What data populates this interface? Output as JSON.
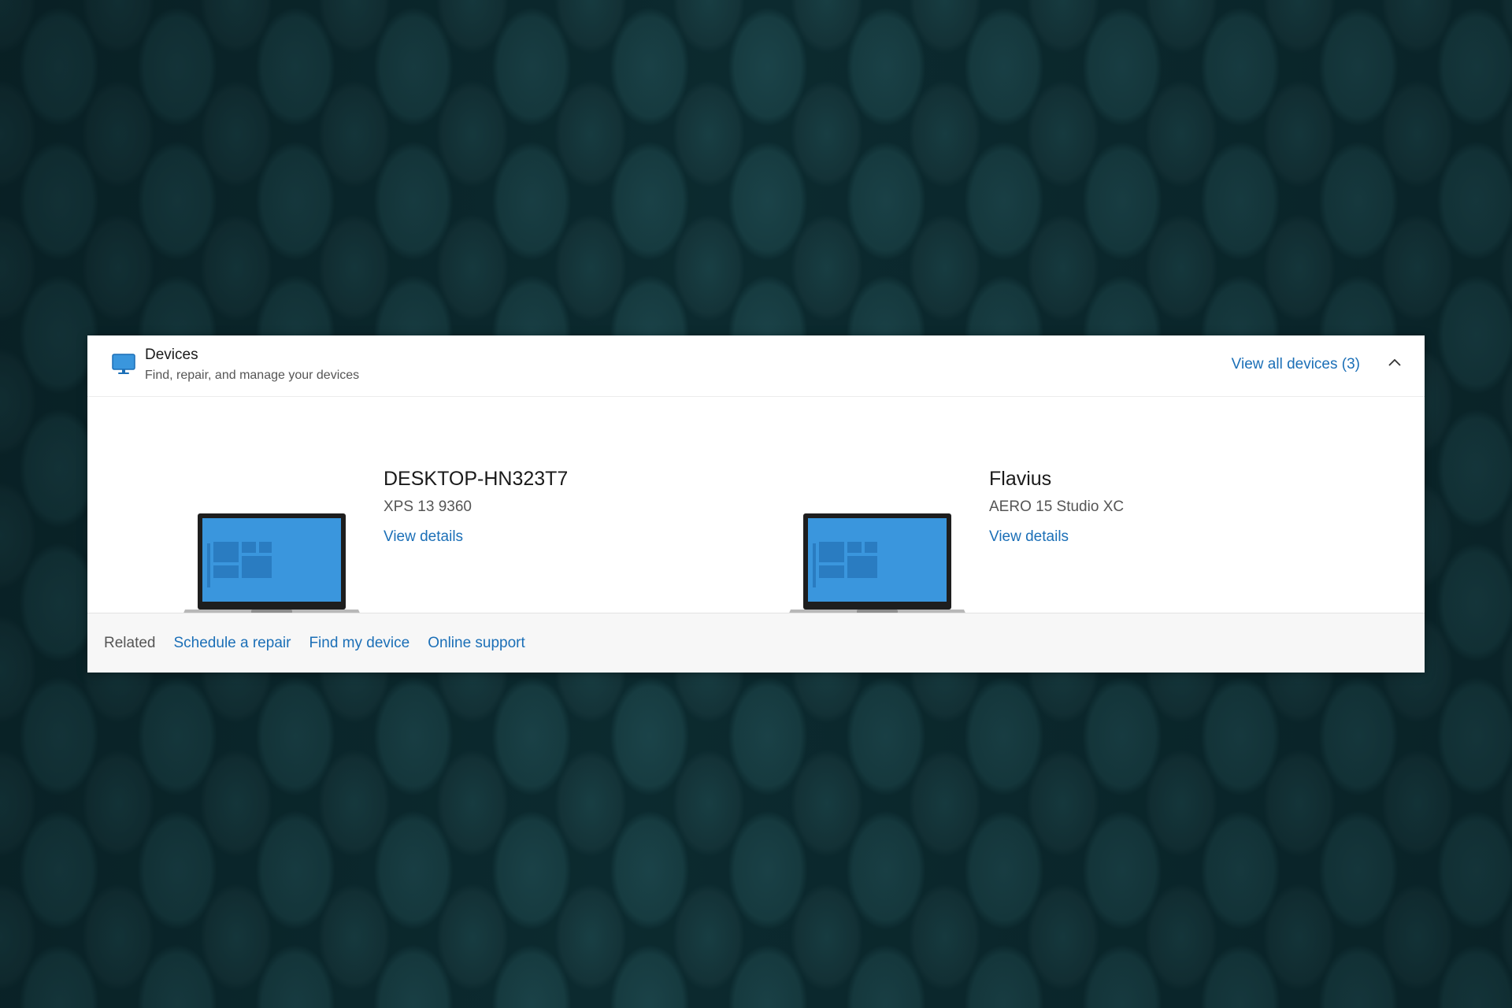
{
  "header": {
    "title": "Devices",
    "subtitle": "Find, repair, and manage your devices",
    "view_all_label": "View all devices (3)",
    "icon": "monitor-icon",
    "collapse_icon": "chevron-up-icon"
  },
  "devices": [
    {
      "name": "DESKTOP-HN323T7",
      "model": "XPS 13 9360",
      "link": "View details",
      "icon": "laptop-icon"
    },
    {
      "name": "Flavius",
      "model": "AERO 15 Studio XC",
      "link": "View details",
      "icon": "laptop-icon"
    }
  ],
  "footer": {
    "label": "Related",
    "links": [
      "Schedule a repair",
      "Find my device",
      "Online support"
    ]
  },
  "colors": {
    "accent": "#1b6fb7",
    "screen_blue": "#3a96dd",
    "background": "#0d2e33"
  }
}
